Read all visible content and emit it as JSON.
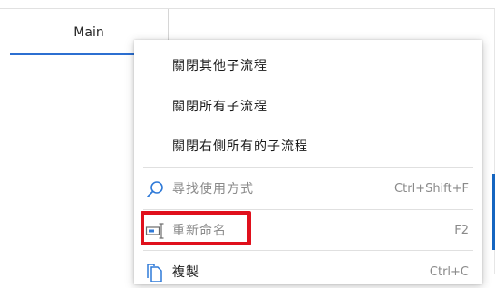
{
  "tab": {
    "label": "Main"
  },
  "menu": {
    "items": [
      {
        "label": "關閉其他子流程",
        "shortcut": "",
        "disabled": false
      },
      {
        "label": "關閉所有子流程",
        "shortcut": "",
        "disabled": false
      },
      {
        "label": "關閉右側所有的子流程",
        "shortcut": "",
        "disabled": false
      },
      {
        "label": "尋找使用方式",
        "shortcut": "Ctrl+Shift+F",
        "disabled": true,
        "icon": "search-icon"
      },
      {
        "label": "重新命名",
        "shortcut": "F2",
        "disabled": true,
        "icon": "rename-icon"
      },
      {
        "label": "複製",
        "shortcut": "Ctrl+C",
        "disabled": false,
        "icon": "copy-icon"
      }
    ]
  },
  "colors": {
    "accent": "#2c6fd1",
    "highlight": "#e0101c",
    "disabled_text": "#8a8a8a",
    "icon_blue": "#2f7ad8"
  }
}
